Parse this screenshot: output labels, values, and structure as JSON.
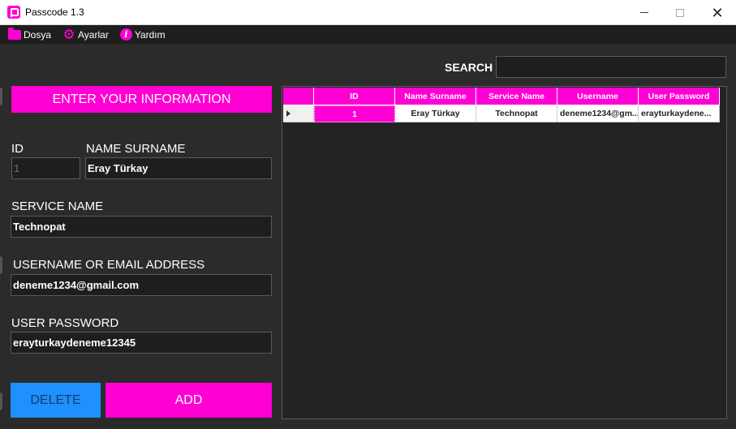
{
  "window": {
    "title": "Passcode 1.3"
  },
  "menu": {
    "items": [
      {
        "label": "Dosya",
        "icon": "folder-icon"
      },
      {
        "label": "Ayarlar",
        "icon": "gear-icon"
      },
      {
        "label": "Yardım",
        "icon": "info-icon"
      }
    ]
  },
  "colors": {
    "accent": "#ff00d4",
    "delete": "#1e90ff",
    "background": "#2b2b2b"
  },
  "form": {
    "banner": "ENTER YOUR INFORMATION",
    "id_label": "ID",
    "id_value": "1",
    "name_label": "NAME SURNAME",
    "name_value": "Eray Türkay",
    "service_label": "SERVICE NAME",
    "service_value": "Technopat",
    "username_label": "USERNAME OR EMAIL ADDRESS",
    "username_value": "deneme1234@gmail.com",
    "password_label": "USER PASSWORD",
    "password_value": "erayturkaydeneme12345",
    "delete_label": "DELETE",
    "add_label": "ADD"
  },
  "search": {
    "label": "SEARCH",
    "value": ""
  },
  "grid": {
    "columns": [
      "ID",
      "Name Surname",
      "Service Name",
      "Username",
      "User Password"
    ],
    "rows": [
      [
        "1",
        "Eray Türkay",
        "Technopat",
        "deneme1234@gm...",
        "erayturkaydene..."
      ]
    ]
  }
}
